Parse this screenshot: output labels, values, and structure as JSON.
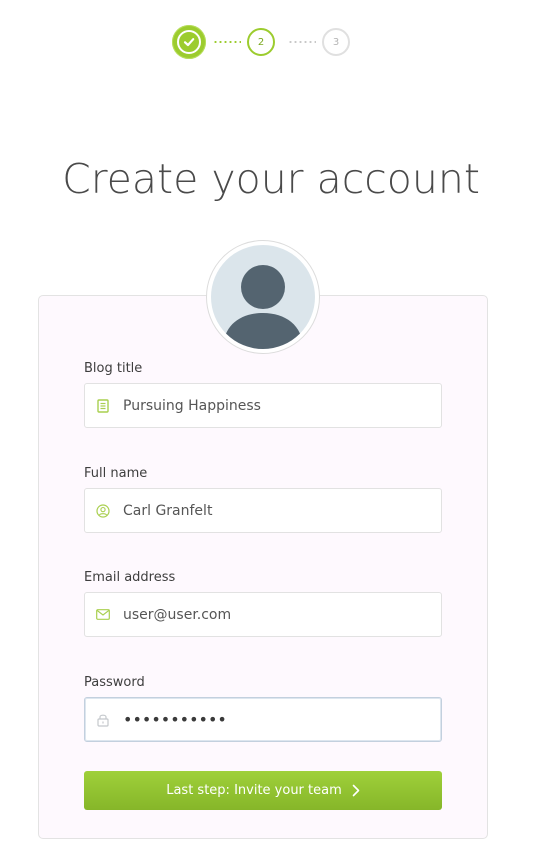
{
  "stepper": {
    "steps": [
      {
        "label": "",
        "state": "done"
      },
      {
        "label": "2",
        "state": "current"
      },
      {
        "label": "3",
        "state": "pending"
      }
    ]
  },
  "title": "Create your account",
  "form": {
    "blog_title": {
      "label": "Blog title",
      "value": "Pursuing Happiness",
      "icon": "document-icon"
    },
    "full_name": {
      "label": "Full name",
      "value": "Carl Granfelt",
      "icon": "user-icon"
    },
    "email": {
      "label": "Email address",
      "value": "user@user.com",
      "icon": "envelope-icon"
    },
    "password": {
      "label": "Password",
      "value": "•••••••••••",
      "icon": "lock-icon"
    }
  },
  "submit_label": "Last step: Invite your team",
  "colors": {
    "accent": "#9ccc2e",
    "accent_dark": "#86b629",
    "card_bg": "#fef9fe",
    "avatar_bg": "#dbe5eb",
    "avatar_fg": "#546470"
  }
}
